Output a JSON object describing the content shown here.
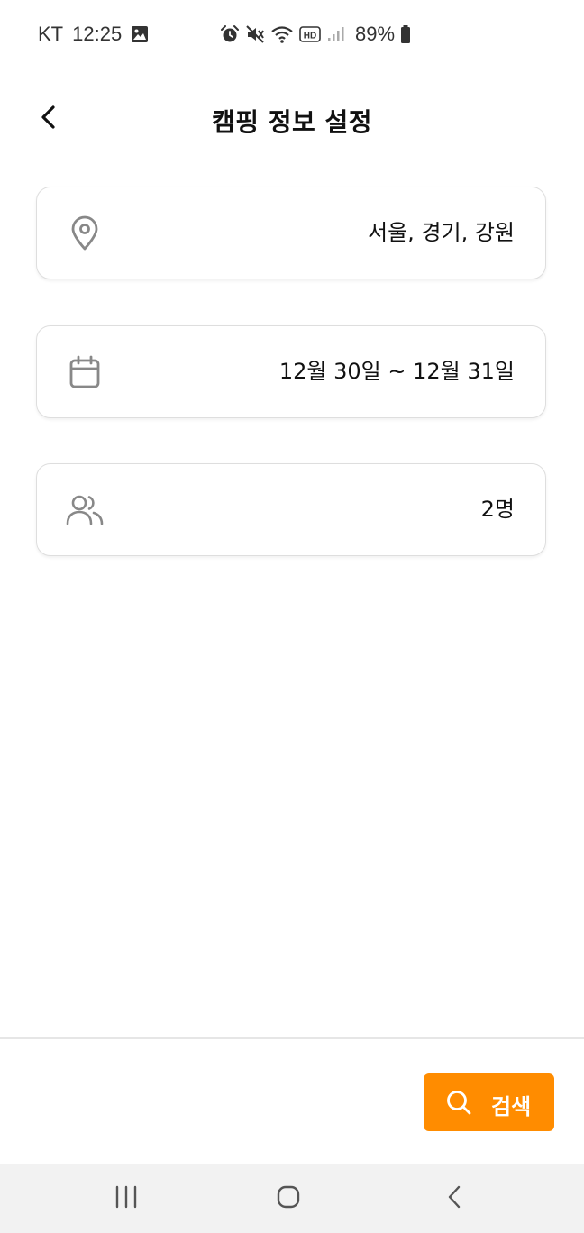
{
  "status_bar": {
    "carrier": "KT",
    "time": "12:25",
    "battery_percent": "89%",
    "hd_label": "HD",
    "icons": [
      "image-icon",
      "alarm-icon",
      "mute-icon",
      "wifi-icon",
      "hd-icon",
      "signal-icon",
      "battery-icon"
    ]
  },
  "header": {
    "title": "캠핑 정보 설정",
    "back_icon": "chevron-left-icon"
  },
  "fields": {
    "location": {
      "value": "서울, 경기, 강원",
      "icon": "location-pin-icon"
    },
    "date": {
      "value": "12월 30일 ~ 12월 31일",
      "icon": "calendar-icon"
    },
    "people": {
      "value": "2명",
      "icon": "users-icon"
    }
  },
  "search_button": {
    "label": "검색",
    "icon": "search-icon",
    "color": "#FF8C00"
  },
  "nav_bar": {
    "icons": [
      "recents-icon",
      "home-icon",
      "back-icon"
    ]
  },
  "colors": {
    "accent": "#FF8C00",
    "card_border": "#DEDEDE",
    "icon_gray": "#888888"
  }
}
